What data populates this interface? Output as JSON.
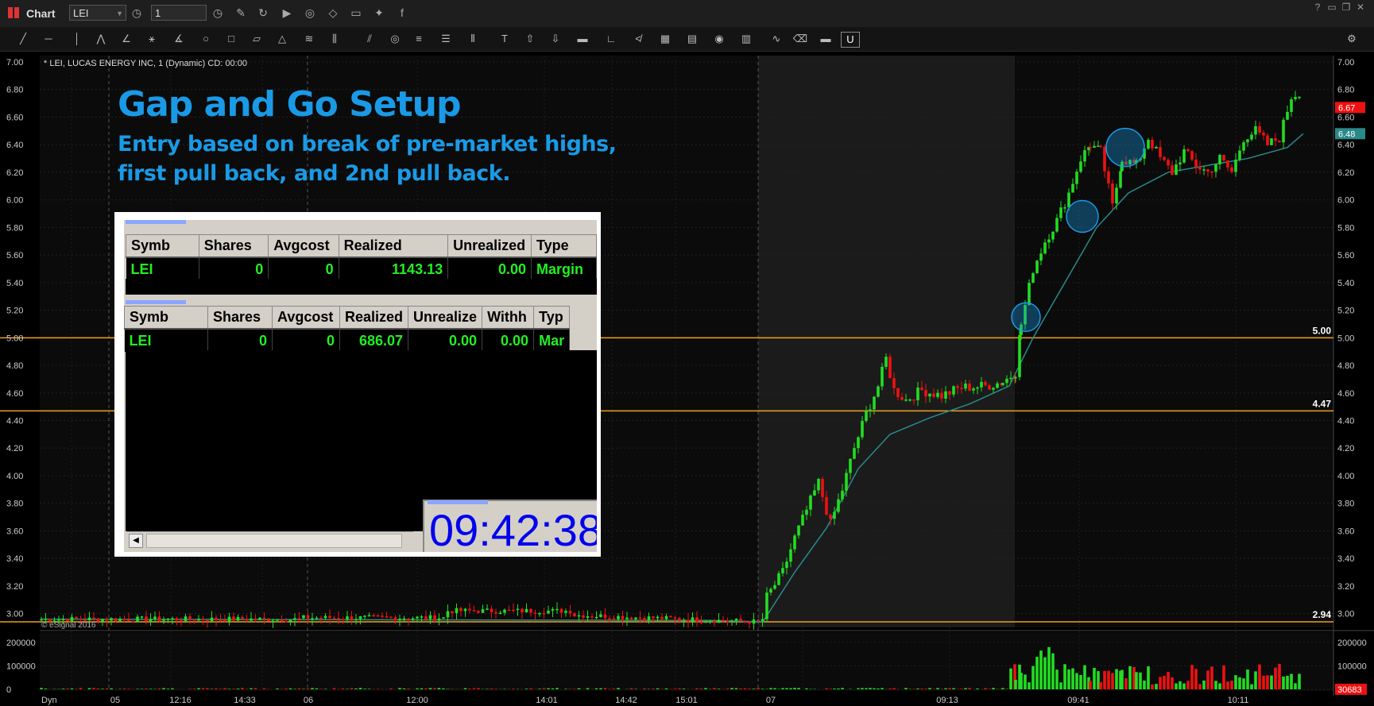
{
  "window": {
    "title": "Chart",
    "symbol": "LEI",
    "interval": "1"
  },
  "chart_header": "* LEI, LUCAS ENERGY INC, 1 (Dynamic) CD: 00:00",
  "overlay": {
    "title": "Gap and Go Setup",
    "subtitle_line1": "Entry based on break of pre-market highs,",
    "subtitle_line2": "first pull back, and 2nd pull back."
  },
  "positions_table_1": {
    "headers": [
      "Symb",
      "Shares",
      "Avgcost",
      "Realized",
      "Unrealized",
      "Type"
    ],
    "row": [
      "LEI",
      "0",
      "0",
      "1143.13",
      "0.00",
      "Margin"
    ]
  },
  "positions_table_2": {
    "headers": [
      "Symb",
      "Shares",
      "Avgcost",
      "Realized",
      "Unrealize",
      "Withh",
      "Typ"
    ],
    "row": [
      "LEI",
      "0",
      "0",
      "686.07",
      "0.00",
      "0.00",
      "Mar"
    ]
  },
  "clock": "09:42:38",
  "copyright": "© eSignal 2016",
  "dyn_label": "Dyn",
  "colors": {
    "up": "#22dd22",
    "down": "#ee1111",
    "level": "#f0a020",
    "ma": "#2a8a8a",
    "annot": "#1a9ae6"
  },
  "chart_data": {
    "type": "candlestick",
    "title": "LEI, LUCAS ENERGY INC, 1 (Dynamic)",
    "y_ticks": [
      "7.00",
      "6.80",
      "6.60",
      "6.40",
      "6.20",
      "6.00",
      "5.80",
      "5.60",
      "5.40",
      "5.20",
      "5.00",
      "4.80",
      "4.60",
      "4.40",
      "4.20",
      "4.00",
      "3.80",
      "3.60",
      "3.40",
      "3.20",
      "3.00"
    ],
    "ylim": [
      2.9,
      7.0
    ],
    "x_ticks": [
      "05",
      "12:16",
      "14:33",
      "06",
      "12:00",
      "14:01",
      "14:42",
      "15:01",
      "07",
      "09:13",
      "09:41",
      "10:11"
    ],
    "levels": [
      {
        "value": 5.0,
        "label": "5.00"
      },
      {
        "value": 4.47,
        "label": "4.47"
      },
      {
        "value": 2.94,
        "label": "2.94"
      }
    ],
    "last_price_tags": [
      {
        "value": 6.67,
        "label": "6.67",
        "color": "#ee1111"
      },
      {
        "value": 6.48,
        "label": "6.48",
        "color": "#2a8a8a"
      }
    ],
    "volume": {
      "y_ticks": [
        "200000",
        "100000",
        "0"
      ],
      "ylim": [
        0,
        230000
      ],
      "last_volume_label": "30683"
    }
  }
}
